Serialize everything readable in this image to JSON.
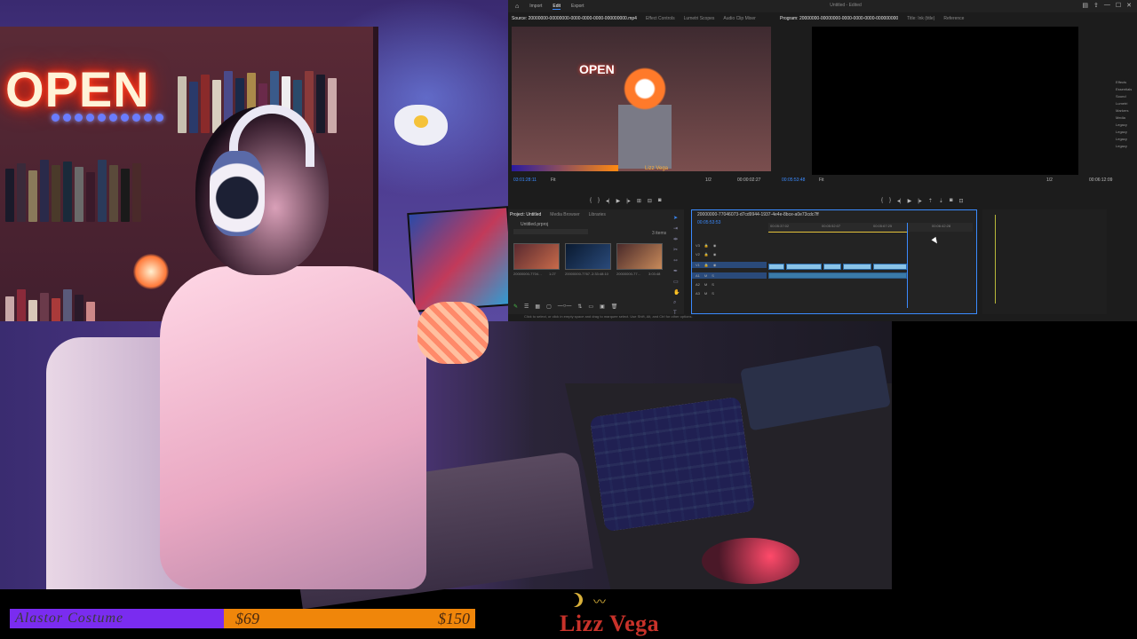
{
  "top_camera": {
    "neon_sign": "OPEN"
  },
  "premiere": {
    "nav": [
      "Import",
      "Edit",
      "Export"
    ],
    "active_nav": "Edit",
    "window_title": "Untitled - Edited",
    "source_tabs": [
      "Source: 20000000-00000000-0000-0000-0000-000000000.mp4",
      "Effect Controls",
      "Lumetri Scopes",
      "Audio Clip Mixer"
    ],
    "program_tabs": [
      "Program: 20000000-00000000-0000-0000-0000-000000000",
      "Title: Ink (title)",
      "Reference"
    ],
    "source_timecode": "03:01:28:11",
    "source_fit": "Fit",
    "source_duration": "00:00:02:27",
    "source_overlay_name": "Lizz Vega",
    "program_timecode": "00:05:53:48",
    "program_fit": "Fit",
    "program_duration": "00:06:12:09",
    "page_fraction": "1/2",
    "project_tabs": [
      "Project: Untitled",
      "Media Browser",
      "Libraries"
    ],
    "project_item": "Untitled.prproj",
    "item_count": "3 items",
    "thumbs": [
      {
        "label": "20000000-7704…",
        "duration": "1:27"
      },
      {
        "label": "20000000-7767…",
        "duration": "2:33:48:10"
      },
      {
        "label": "20000000-77…",
        "duration": "3:03:48"
      }
    ],
    "timeline_title": "20000000-77046073-d7cd9944-1937-4e4e-8bce-a0e73cdc7ff",
    "timeline_timecode": "00:05:53:53",
    "ruler_marks": [
      "00:05:37:02",
      "00:05:52:07",
      "00:05:67:25",
      "00:06:42:28"
    ],
    "video_tracks": [
      "V3",
      "V2",
      "V1"
    ],
    "audio_tracks": [
      "A1",
      "A2",
      "A3"
    ],
    "right_rail": [
      "Effects",
      "Essentials",
      "Sound",
      "Lumetri",
      "Markers",
      "Media",
      "Legacy",
      "Legacy",
      "Legacy",
      "Legacy"
    ],
    "status_text": "Click to select, or click in empty space and drag to marquee select. Use Shift, Alt, and Ctrl for other options."
  },
  "goal": {
    "label": "Alastor Costume",
    "current": "$69",
    "target": "$150",
    "progress_fraction": 0.46,
    "fill_color": "#7a2cf0",
    "track_color": "#f0860a"
  },
  "brand": {
    "name": "Lizz Vega",
    "color": "#c8322a"
  }
}
